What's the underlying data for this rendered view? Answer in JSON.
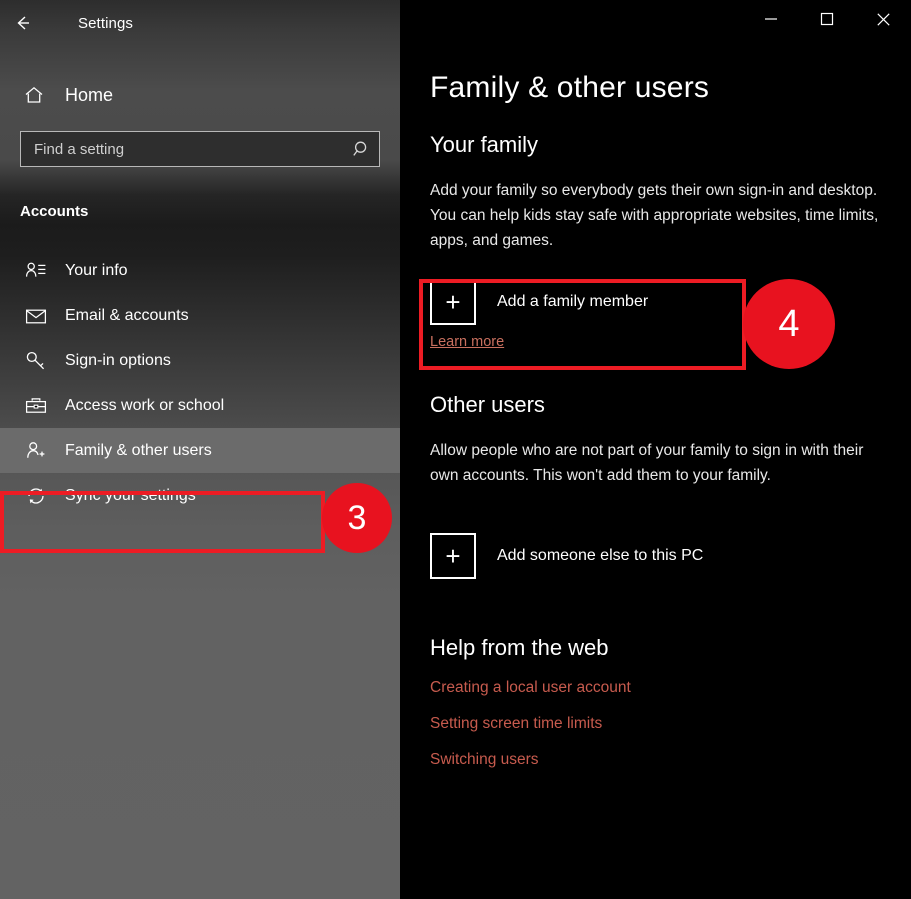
{
  "window": {
    "title": "Settings",
    "back_icon": "back-arrow-icon",
    "controls": {
      "minimize": "—",
      "maximize": "☐",
      "close": "✕"
    }
  },
  "sidebar": {
    "home": {
      "label": "Home",
      "icon": "home-icon"
    },
    "search": {
      "placeholder": "Find a setting",
      "value": "",
      "icon": "search-icon"
    },
    "section_label": "Accounts",
    "items": [
      {
        "label": "Your info",
        "icon": "person-card-icon",
        "selected": false
      },
      {
        "label": "Email & accounts",
        "icon": "envelope-icon",
        "selected": false
      },
      {
        "label": "Sign-in options",
        "icon": "key-icon",
        "selected": false
      },
      {
        "label": "Access work or school",
        "icon": "briefcase-icon",
        "selected": false
      },
      {
        "label": "Family & other users",
        "icon": "person-add-icon",
        "selected": true
      },
      {
        "label": "Sync your settings",
        "icon": "sync-icon",
        "selected": false
      }
    ]
  },
  "main": {
    "page_title": "Family & other users",
    "your_family": {
      "heading": "Your family",
      "description": "Add your family so everybody gets their own sign-in and desktop. You can help kids stay safe with appropriate websites, time limits, apps, and games.",
      "add_button": {
        "label": "Add a family member",
        "icon": "plus-square-icon"
      },
      "learn_more": "Learn more"
    },
    "other_users": {
      "heading": "Other users",
      "description": "Allow people who are not part of your family to sign in with their own accounts. This won't add them to your family.",
      "add_button": {
        "label": "Add someone else to this PC",
        "icon": "plus-square-icon"
      }
    },
    "help": {
      "heading": "Help from the web",
      "links": [
        "Creating a local user account",
        "Setting screen time limits",
        "Switching users"
      ]
    }
  },
  "annotations": {
    "color": "#ed1c24",
    "badges": [
      {
        "number": "3",
        "target": "sidebar-item-family-other-users"
      },
      {
        "number": "4",
        "target": "add-family-member-button"
      }
    ]
  }
}
